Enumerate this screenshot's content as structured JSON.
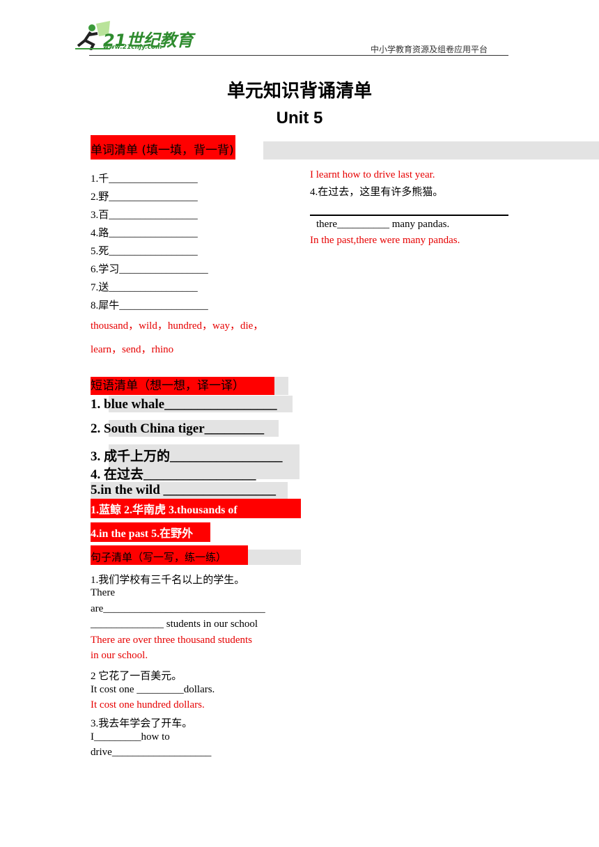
{
  "header": {
    "logo_text": "21世纪教育",
    "logo_url": "www.21cnjy.com",
    "tagline": "中小学教育资源及组卷应用平台"
  },
  "title": "单元知识背诵清单",
  "subtitle": "Unit 5",
  "words": {
    "heading": "单词清单 (填一填，背一背)",
    "items": [
      "1.千_________________",
      "2.野_________________",
      "3.百_________________",
      "4.路_________________",
      "5.死_________________",
      "6.学习_________________",
      "7.送_________________",
      "8.犀牛_________________"
    ],
    "answer1": "thousand，wild，hundred，way，die，",
    "answer2": "learn，send，rhino"
  },
  "phrases": {
    "heading": "短语清单（想一想，译一译）",
    "items": [
      "1.  blue whale_________________",
      "2.  South China tiger_________",
      "3.  成千上万的_________________",
      "4.  在过去_________________",
      "5.in the wild _________________"
    ],
    "answer1": "1.蓝鲸     2.华南虎     3.thousands of",
    "answer2": "4.in the past   5.在野外"
  },
  "sentences": {
    "heading": "句子清单（写一写，练一练）",
    "s1": [
      "1.我们学校有三千名以上的学生。",
      "There",
      "are_______________________________",
      "______________ students in our school"
    ],
    "a1": [
      "There are over three thousand students",
      "in our school."
    ],
    "s2": [
      "2 它花了一百美元。",
      "It cost one _________dollars."
    ],
    "a2": "It cost one hundred dollars.",
    "s3": [
      "3.我去年学会了开车。",
      "I_________how to",
      "drive___________________"
    ],
    "a3": "I learnt how to drive last year.",
    "s4": [
      "4.在过去，这里有许多熊猫。",
      "there__________ many pandas."
    ],
    "a4": "In the past,there were many pandas."
  }
}
